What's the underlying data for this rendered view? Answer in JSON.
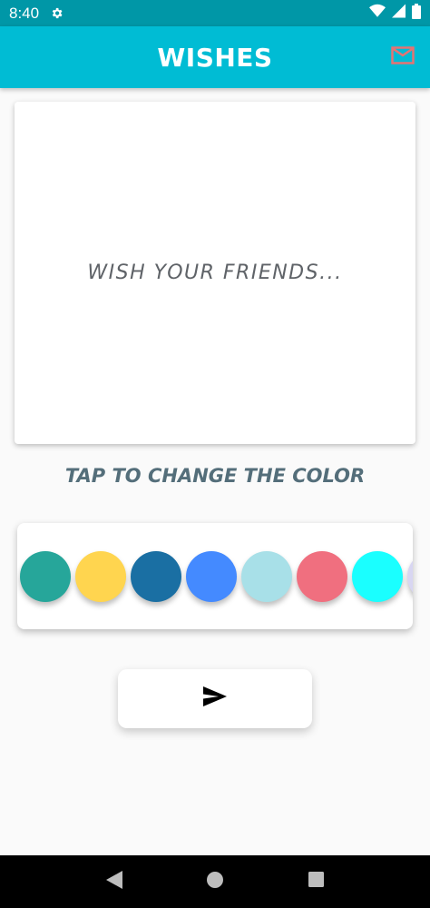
{
  "status_bar": {
    "time": "8:40",
    "icons": [
      "gear-icon",
      "wifi-icon",
      "signal-icon",
      "battery-icon"
    ]
  },
  "app_bar": {
    "title": "WISHES",
    "mail_icon": "mail-icon",
    "mail_color": "#e57373"
  },
  "card": {
    "placeholder_text": "WISH YOUR FRIENDS..."
  },
  "palette": {
    "label": "TAP TO CHANGE THE COLOR",
    "swatches": [
      "#26a69a",
      "#ffd54f",
      "#1a6fa3",
      "#448aff",
      "#a8e0e8",
      "#f06f7f",
      "#1affff",
      "#d8d6f2"
    ]
  },
  "send_button": {
    "icon": "send-icon"
  },
  "nav_bar": {
    "icons": [
      "back-icon",
      "home-icon",
      "recents-icon"
    ]
  },
  "colors": {
    "status_bar": "#0097a7",
    "app_bar": "#00bcd4",
    "background": "#fafafa",
    "label_text": "#546e7a"
  }
}
